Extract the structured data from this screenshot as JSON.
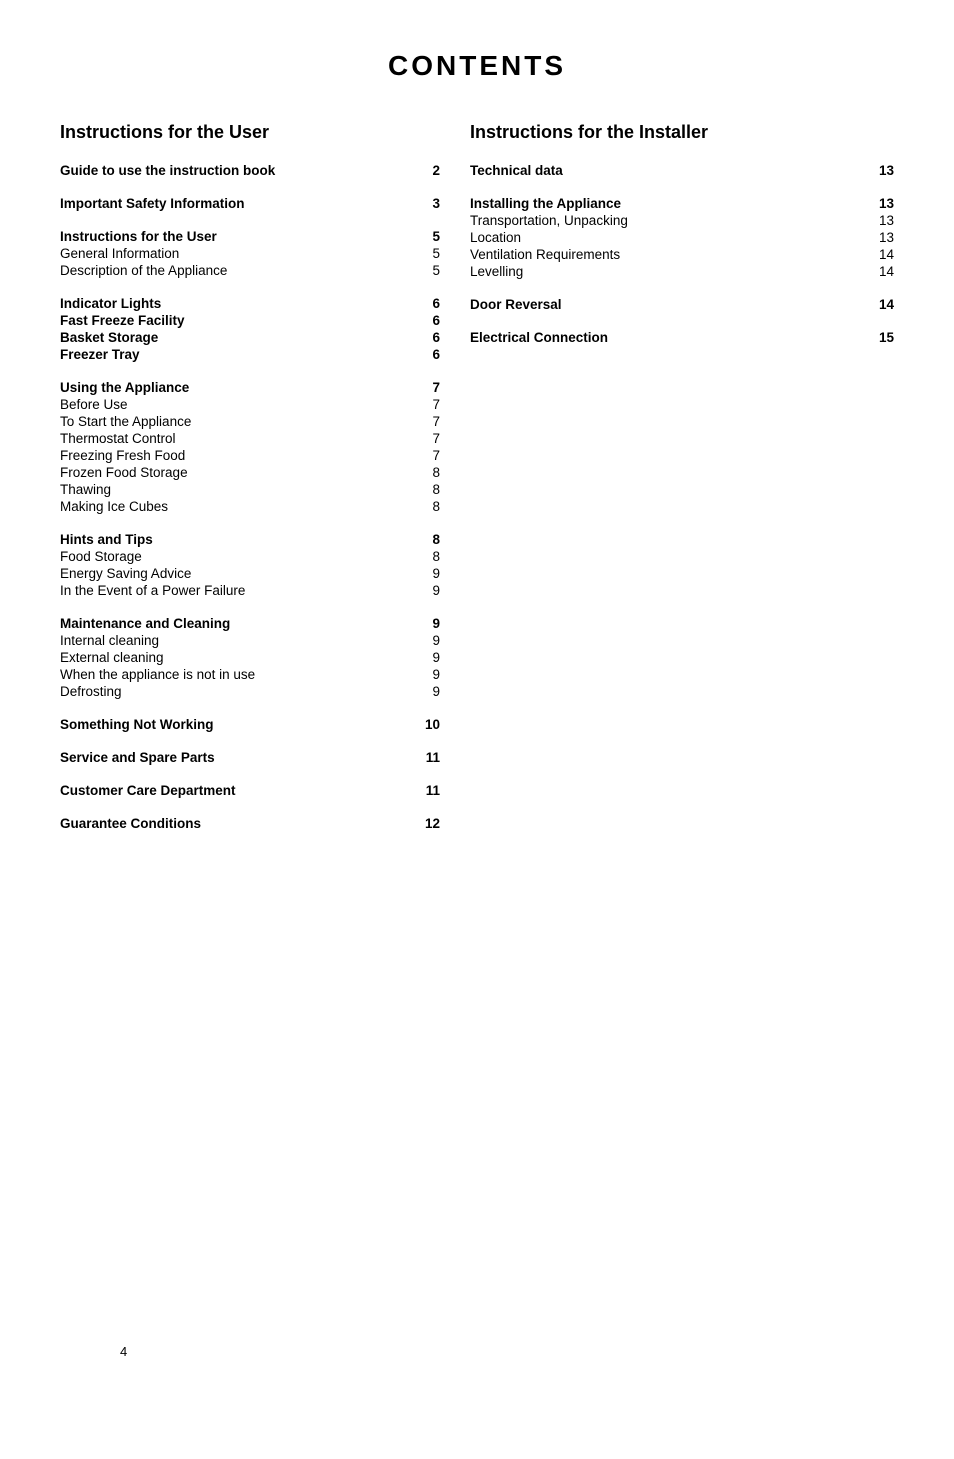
{
  "title": "CONTENTS",
  "left_column_heading": "Instructions for the User",
  "right_column_heading": "Instructions for the Installer",
  "left_groups": [
    {
      "id": "group-guide",
      "entries": [
        {
          "label": "Guide to use the instruction book",
          "page": "2",
          "bold": true
        }
      ]
    },
    {
      "id": "group-safety",
      "entries": [
        {
          "label": "Important Safety Information",
          "page": "3",
          "bold": true
        }
      ]
    },
    {
      "id": "group-instructions",
      "entries": [
        {
          "label": "Instructions for the User",
          "page": "5",
          "bold": true
        },
        {
          "label": "General Information",
          "page": "5",
          "bold": false
        },
        {
          "label": "Description of the Appliance",
          "page": "5",
          "bold": false
        }
      ]
    },
    {
      "id": "group-indicator",
      "entries": [
        {
          "label": "Indicator Lights",
          "page": "6",
          "bold": true
        },
        {
          "label": "Fast Freeze Facility",
          "page": "6",
          "bold": true
        },
        {
          "label": "Basket Storage",
          "page": "6",
          "bold": true
        },
        {
          "label": "Freezer Tray",
          "page": "6",
          "bold": true
        }
      ]
    },
    {
      "id": "group-using",
      "entries": [
        {
          "label": "Using the Appliance",
          "page": "7",
          "bold": true
        },
        {
          "label": "Before Use",
          "page": "7",
          "bold": false
        },
        {
          "label": "To Start the Appliance",
          "page": "7",
          "bold": false
        },
        {
          "label": "Thermostat Control",
          "page": "7",
          "bold": false
        },
        {
          "label": "Freezing Fresh Food",
          "page": "7",
          "bold": false
        },
        {
          "label": "Frozen Food Storage",
          "page": "8",
          "bold": false
        },
        {
          "label": "Thawing",
          "page": "8",
          "bold": false
        },
        {
          "label": "Making Ice Cubes",
          "page": "8",
          "bold": false
        }
      ]
    },
    {
      "id": "group-hints",
      "entries": [
        {
          "label": "Hints and Tips",
          "page": "8",
          "bold": true
        },
        {
          "label": "Food Storage",
          "page": "8",
          "bold": false
        },
        {
          "label": "Energy Saving Advice",
          "page": "9",
          "bold": false
        },
        {
          "label": "In the Event of a Power Failure",
          "page": "9",
          "bold": false
        }
      ]
    },
    {
      "id": "group-maintenance",
      "entries": [
        {
          "label": "Maintenance and Cleaning",
          "page": "9",
          "bold": true
        },
        {
          "label": "Internal cleaning",
          "page": "9",
          "bold": false
        },
        {
          "label": "External cleaning",
          "page": "9",
          "bold": false
        },
        {
          "label": "When the appliance is not in use",
          "page": "9",
          "bold": false
        },
        {
          "label": "Defrosting",
          "page": "9",
          "bold": false
        }
      ]
    },
    {
      "id": "group-notworking",
      "entries": [
        {
          "label": "Something Not Working",
          "page": "10",
          "bold": true
        }
      ]
    },
    {
      "id": "group-service",
      "entries": [
        {
          "label": "Service and Spare Parts",
          "page": "11",
          "bold": true
        }
      ]
    },
    {
      "id": "group-customer",
      "entries": [
        {
          "label": "Customer Care Department",
          "page": "11",
          "bold": true
        }
      ]
    },
    {
      "id": "group-guarantee",
      "entries": [
        {
          "label": "Guarantee Conditions",
          "page": "12",
          "bold": true
        }
      ]
    }
  ],
  "right_groups": [
    {
      "id": "group-technical",
      "entries": [
        {
          "label": "Technical data",
          "page": "13",
          "bold": true
        }
      ]
    },
    {
      "id": "group-installing",
      "entries": [
        {
          "label": "Installing the Appliance",
          "page": "13",
          "bold": true
        },
        {
          "label": "Transportation, Unpacking",
          "page": "13",
          "bold": false
        },
        {
          "label": "Location",
          "page": "13",
          "bold": false
        },
        {
          "label": "Ventilation Requirements",
          "page": "14",
          "bold": false
        },
        {
          "label": "Levelling",
          "page": "14",
          "bold": false
        }
      ]
    },
    {
      "id": "group-door",
      "entries": [
        {
          "label": "Door Reversal",
          "page": "14",
          "bold": true
        }
      ]
    },
    {
      "id": "group-electrical",
      "entries": [
        {
          "label": "Electrical Connection",
          "page": "15",
          "bold": true
        }
      ]
    }
  ],
  "page_number": "4"
}
